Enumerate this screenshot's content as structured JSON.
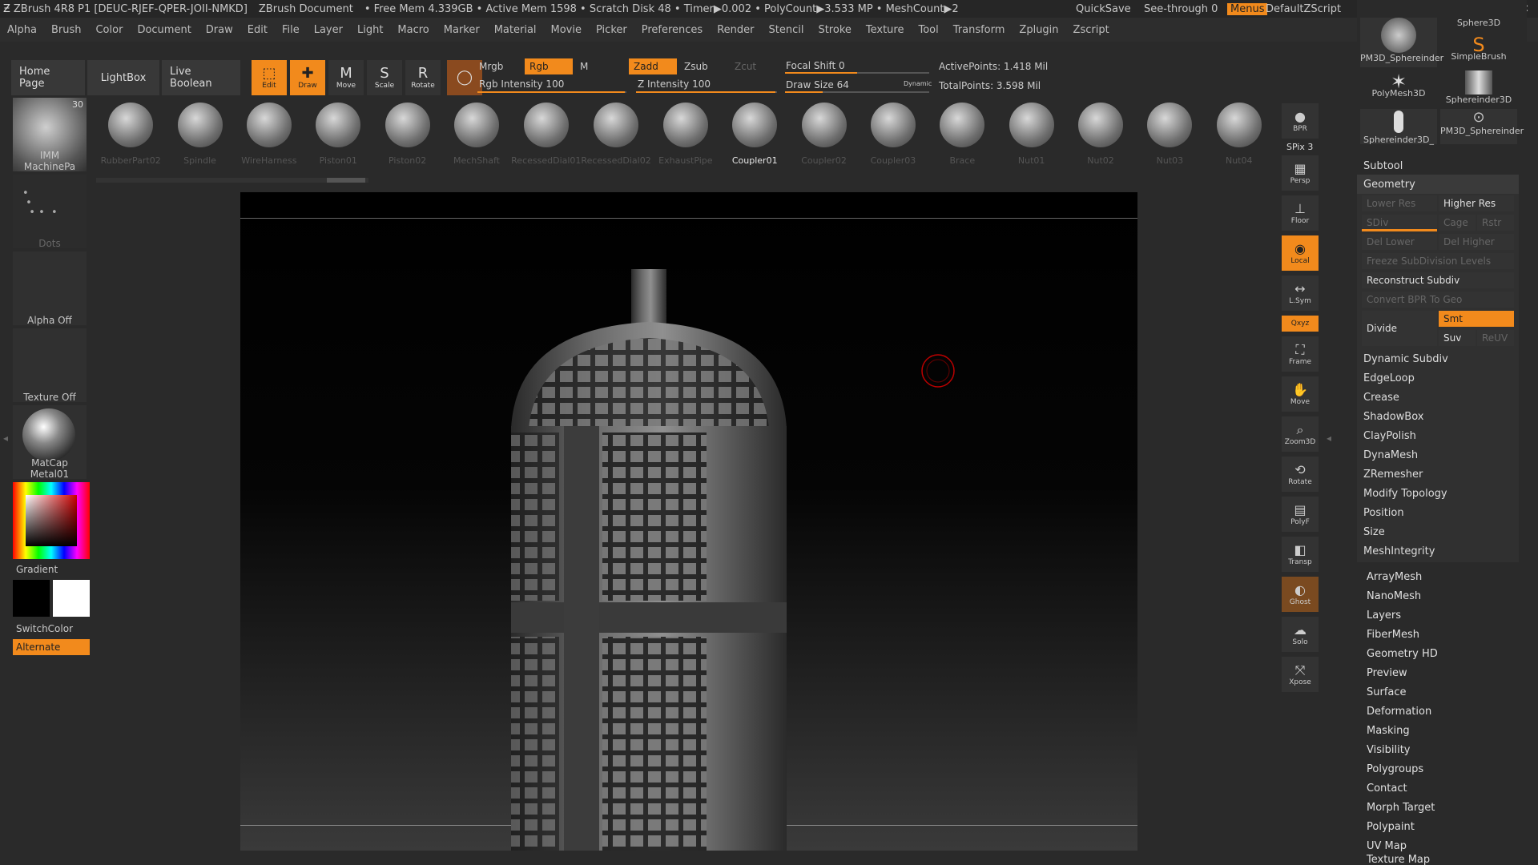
{
  "titlebar": {
    "app": "ZBrush 4R8 P1 [DEUC-RJEF-QPER-JOII-NMKD]",
    "doc": "ZBrush Document",
    "stats": "• Free Mem 4.339GB • Active Mem 1598 • Scratch Disk 48 • Timer▶0.002 • PolyCount▶3.533 MP • MeshCount▶2",
    "quicksave": "QuickSave",
    "seethrough": "See-through  0",
    "menus": "Menus",
    "script": "DefaultZScript"
  },
  "menu": [
    "Alpha",
    "Brush",
    "Color",
    "Document",
    "Draw",
    "Edit",
    "File",
    "Layer",
    "Light",
    "Macro",
    "Marker",
    "Material",
    "Movie",
    "Picker",
    "Preferences",
    "Render",
    "Stencil",
    "Stroke",
    "Texture",
    "Tool",
    "Transform",
    "Zplugin",
    "Zscript"
  ],
  "toolbar": {
    "home": "Home Page",
    "lightbox": "LightBox",
    "liveboolean": "Live Boolean",
    "edit": "Edit",
    "draw": "Draw",
    "move": "Move",
    "scale": "Scale",
    "rotate": "Rotate"
  },
  "drawparams": {
    "mrgb": "Mrgb",
    "rgb": "Rgb",
    "m": "M",
    "zadd": "Zadd",
    "zsub": "Zsub",
    "zcut": "Zcut",
    "rgb_int": "Rgb Intensity 100",
    "z_int": "Z Intensity 100",
    "focal": "Focal Shift 0",
    "drawsize": "Draw Size 64",
    "dynamic": "Dynamic",
    "active": "ActivePoints: 1.418 Mil",
    "total": "TotalPoints: 3.598 Mil"
  },
  "shelf": [
    {
      "label": "RubberPart02"
    },
    {
      "label": "Spindle"
    },
    {
      "label": "WireHarness"
    },
    {
      "label": "Piston01"
    },
    {
      "label": "Piston02"
    },
    {
      "label": "MechShaft"
    },
    {
      "label": "RecessedDial01"
    },
    {
      "label": "RecessedDial02"
    },
    {
      "label": "ExhaustPipe"
    },
    {
      "label": "Coupler01"
    },
    {
      "label": "Coupler02"
    },
    {
      "label": "Coupler03"
    },
    {
      "label": "Brace"
    },
    {
      "label": "Nut01"
    },
    {
      "label": "Nut02"
    },
    {
      "label": "Nut03"
    },
    {
      "label": "Nut04"
    }
  ],
  "left": {
    "brush": "IMM MachinePa",
    "brush_count": "30",
    "stroke": "Dots",
    "alpha": "Alpha Off",
    "texture": "Texture Off",
    "material": "MatCap Metal01",
    "gradient": "Gradient",
    "switch": "SwitchColor",
    "alternate": "Alternate"
  },
  "rightstrip": [
    {
      "label": "BPR"
    },
    {
      "label": "SPix 3"
    },
    {
      "label": "Persp"
    },
    {
      "label": "Floor"
    },
    {
      "label": "Local"
    },
    {
      "label": "L.Sym"
    },
    {
      "label": "Qxyz"
    },
    {
      "label": "Frame"
    },
    {
      "label": "Move"
    },
    {
      "label": "Zoom3D"
    },
    {
      "label": "Rotate"
    },
    {
      "label": "PolyF"
    },
    {
      "label": "Transp"
    },
    {
      "label": "Ghost"
    },
    {
      "label": "Solo"
    },
    {
      "label": "Xpose"
    }
  ],
  "tools": [
    {
      "label": "PM3D_Sphereinder"
    },
    {
      "label": "Sphere3D"
    },
    {
      "label": "SimpleBrush"
    },
    {
      "label": "PolyMesh3D"
    },
    {
      "label": "Sphereinder3D"
    },
    {
      "label": "Sphereinder3D_"
    },
    {
      "label": "PM3D_Sphereinder"
    }
  ],
  "panel": {
    "subtool": "Subtool",
    "geometry": "Geometry",
    "lowerres": "Lower Res",
    "higherres": "Higher Res",
    "sdiv": "SDiv",
    "cage": "Cage",
    "rstr": "Rstr",
    "dellower": "Del Lower",
    "delhigher": "Del Higher",
    "freeze": "Freeze SubDivision Levels",
    "reconstruct": "Reconstruct Subdiv",
    "convert": "Convert BPR To Geo",
    "divide": "Divide",
    "smt": "Smt",
    "suv": "Suv",
    "reuv": "ReUV",
    "geo_items": [
      "Dynamic Subdiv",
      "EdgeLoop",
      "Crease",
      "ShadowBox",
      "ClayPolish",
      "DynaMesh",
      "ZRemesher",
      "Modify Topology",
      "Position",
      "Size",
      "MeshIntegrity"
    ],
    "sub_items": [
      "ArrayMesh",
      "NanoMesh",
      "Layers",
      "FiberMesh",
      "Geometry HD",
      "Preview",
      "Surface",
      "Deformation",
      "Masking",
      "Visibility",
      "Polygroups",
      "Contact",
      "Morph Target",
      "Polypaint",
      "UV Map",
      "Texture Map"
    ]
  }
}
